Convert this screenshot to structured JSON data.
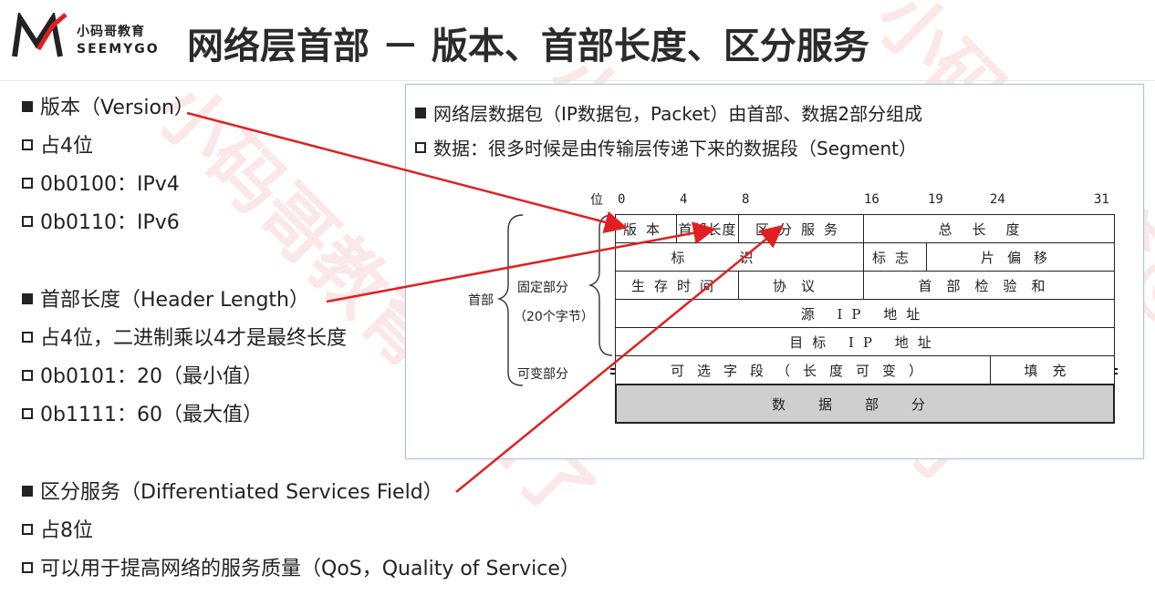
{
  "brand": {
    "cn": "小码哥教育",
    "en": "SEEMYGO"
  },
  "title": "网络层首部 － 版本、首部长度、区分服务",
  "left": {
    "items": [
      {
        "type": "main",
        "text": "版本（Version）"
      },
      {
        "type": "sub",
        "text": "占4位"
      },
      {
        "type": "sub",
        "text": "0b0100：IPv4"
      },
      {
        "type": "sub",
        "text": "0b0110：IPv6"
      },
      {
        "type": "main",
        "text": "首部长度（Header Length）"
      },
      {
        "type": "sub",
        "text": "占4位，二进制乘以4才是最终长度"
      },
      {
        "type": "sub",
        "text": "0b0101：20（最小值）"
      },
      {
        "type": "sub",
        "text": "0b1111：60（最大值）"
      },
      {
        "type": "main",
        "text": "区分服务（Differentiated Services Field）"
      },
      {
        "type": "sub",
        "text": "占8位"
      },
      {
        "type": "sub",
        "text": "可以用于提高网络的服务质量（QoS，Quality of Service）"
      }
    ]
  },
  "right": {
    "line1": "网络层数据包（IP数据包，Packet）由首部、数据2部分组成",
    "line2": "数据：很多时候是由传输层传递下来的数据段（Segment）",
    "bit_label": "位",
    "bit_positions": [
      "0",
      "4",
      "8",
      "16",
      "19",
      "24",
      "31"
    ],
    "fields": {
      "version": "版本",
      "header_length": "首部长度",
      "ds": "区分服务",
      "total_length": "总长度",
      "identification": "标识",
      "flags": "标志",
      "fragment_offset": "片偏移",
      "ttl": "生存时间",
      "protocol": "协议",
      "checksum": "首部检验和",
      "src_ip": "源 IP 地址",
      "dst_ip": "目标 IP 地址",
      "options": "可选字段（长度可变）",
      "padding": "填充",
      "data": "数据部分"
    },
    "labels": {
      "header": "首部",
      "fixed": "固定部分",
      "fixed_size": "（20个字节）",
      "variable": "可变部分"
    }
  },
  "colors": {
    "arrow": "#e02020",
    "box_border": "#aac4e3",
    "data_fill": "#cfcfcf"
  },
  "watermark": "小码哥教育@M了"
}
